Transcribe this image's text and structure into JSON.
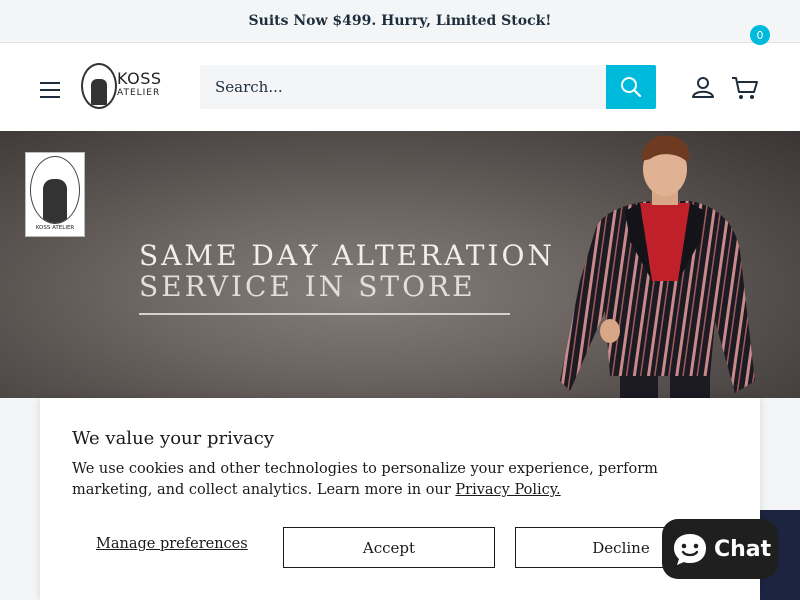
{
  "announcement": {
    "text": "Suits Now $499. Hurry, Limited Stock!"
  },
  "header": {
    "logo": {
      "line1": "KOSS",
      "line2": "ATELIER"
    },
    "search": {
      "placeholder": "Search..."
    },
    "cart": {
      "count": "0"
    }
  },
  "hero": {
    "badge_text": "KOSS ATELIER",
    "line1": "SAME DAY ALTERATION",
    "line2": "SERVICE IN STORE"
  },
  "cookie_banner": {
    "title": "We value your privacy",
    "text": "We use cookies and other technologies to personalize your experience, perform marketing, and collect analytics. Learn more in our ",
    "policy_link": "Privacy Policy.",
    "manage_label": "Manage preferences",
    "accept_label": "Accept",
    "decline_label": "Decline"
  },
  "chat": {
    "label": "Chat"
  },
  "colors": {
    "accent": "#00badb",
    "text": "#1e2d3d",
    "chat_bg": "#1f1f1f"
  },
  "icons": [
    "menu-icon",
    "search-icon",
    "account-icon",
    "cart-icon",
    "chat-bubble-icon"
  ]
}
